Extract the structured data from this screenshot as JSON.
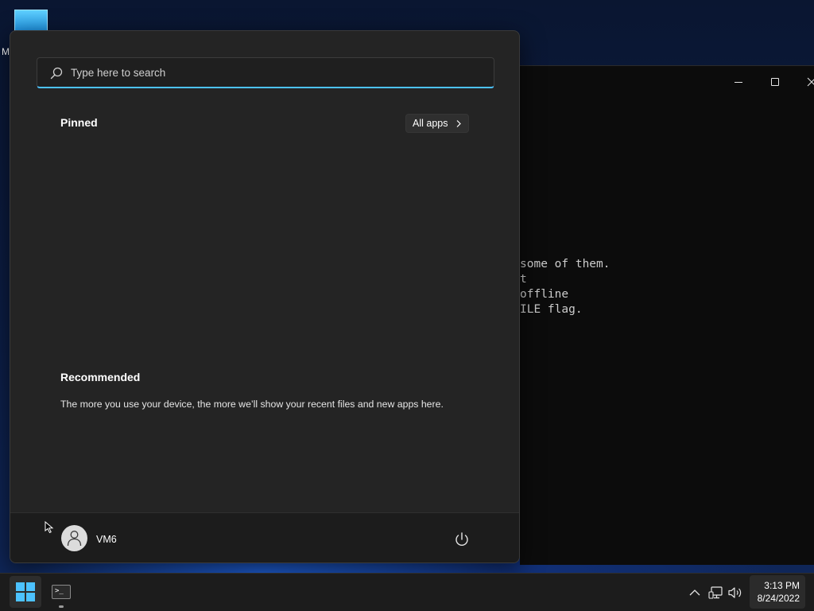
{
  "desktop": {
    "icon_label": "M"
  },
  "terminal": {
    "lines": [
      "some of them.",
      "t",
      "offline",
      "ILE flag."
    ]
  },
  "start_menu": {
    "search": {
      "placeholder": "Type here to search",
      "value": ""
    },
    "pinned_heading": "Pinned",
    "all_apps_label": "All apps",
    "recommended_heading": "Recommended",
    "recommended_text": "The more you use your device, the more we’ll show your recent files and new apps here.",
    "user_name": "VM6"
  },
  "taskbar": {
    "time": "3:13 PM",
    "date": "8/24/2022"
  },
  "colors": {
    "accent": "#4cc2ff",
    "menu_bg": "#242424",
    "taskbar_bg": "#1c1c1c"
  }
}
